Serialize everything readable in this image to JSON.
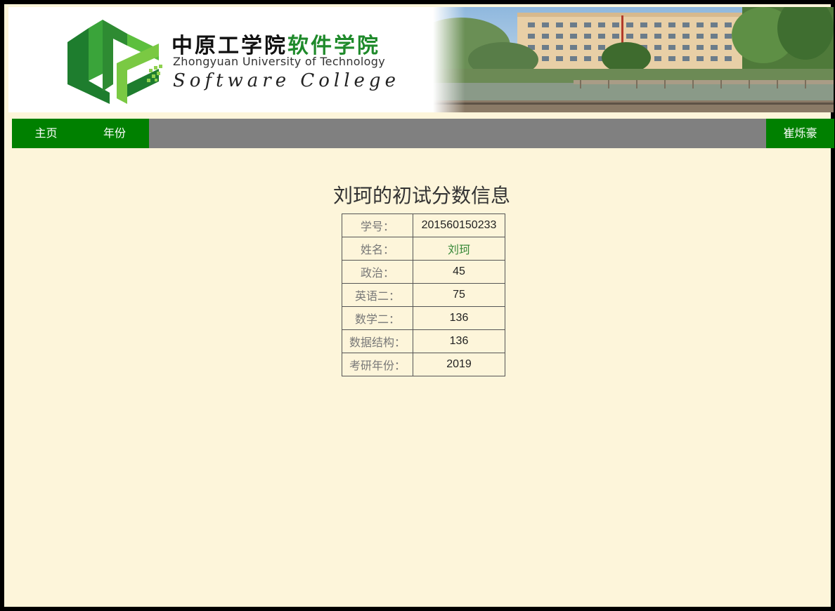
{
  "banner": {
    "title_cn_part1": "中原工学院",
    "title_cn_part2": "软件学院",
    "title_en": "Zhongyuan University of Technology",
    "title_college": "Software College",
    "brand_green": "#1f8a2b",
    "logo_icon": "zut-logo-icon",
    "photo": "campus-building-photo"
  },
  "nav": {
    "home_label": "主页",
    "year_label": "年份",
    "user_label": "崔烁豪",
    "nav_green": "#008000",
    "nav_gray": "#808080"
  },
  "main": {
    "page_title": "刘珂的初试分数信息",
    "rows": [
      {
        "label": "学号：",
        "value": "201560150233"
      },
      {
        "label": "姓名：",
        "value": "刘珂"
      },
      {
        "label": "政治：",
        "value": "45"
      },
      {
        "label": "英语二：",
        "value": "75"
      },
      {
        "label": "数学二：",
        "value": "136"
      },
      {
        "label": "数据结构：",
        "value": "136"
      },
      {
        "label": "考研年份：",
        "value": "2019"
      }
    ]
  },
  "colors": {
    "background": "#fdf5da",
    "name_green": "#3a8a3a"
  }
}
